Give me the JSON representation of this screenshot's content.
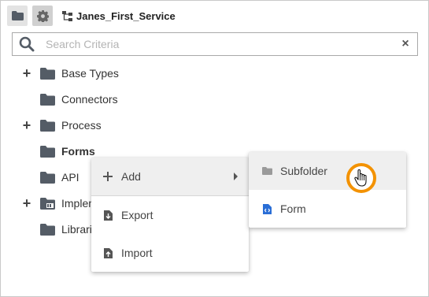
{
  "toolbar": {
    "service_name": "Janes_First_Service"
  },
  "search": {
    "placeholder": "Search Criteria",
    "clear_label": "×"
  },
  "tree": {
    "items": [
      {
        "label": "Base Types",
        "expandable": true,
        "bold": false
      },
      {
        "label": "Connectors",
        "expandable": false,
        "bold": false
      },
      {
        "label": "Process",
        "expandable": true,
        "bold": false
      },
      {
        "label": "Forms",
        "expandable": false,
        "bold": true
      },
      {
        "label": "API",
        "expandable": false,
        "bold": false
      },
      {
        "label": "Implementations",
        "expandable": true,
        "bold": false
      },
      {
        "label": "Libraries",
        "expandable": false,
        "bold": false
      }
    ]
  },
  "context_menu": {
    "add": "Add",
    "export": "Export",
    "import": "Import"
  },
  "submenu": {
    "subfolder": "Subfolder",
    "form": "Form"
  },
  "colors": {
    "folder": "#545c66",
    "accent_ring": "#f39200",
    "form_icon": "#2a6ed6"
  }
}
